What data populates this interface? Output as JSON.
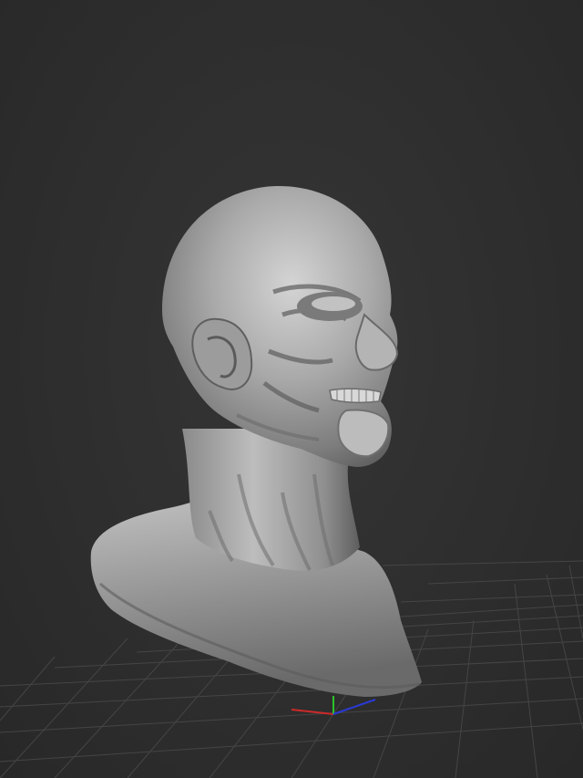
{
  "viewport": {
    "view": "3d-sculpt-viewport",
    "model": "bust",
    "background_color": "#2e2e2e",
    "grid_color": "#4a4a4a",
    "grid_visible": true,
    "gizmo_axes": [
      {
        "axis": "x",
        "color": "#cc2a2a"
      },
      {
        "axis": "y",
        "color": "#2ac42a"
      },
      {
        "axis": "z",
        "color": "#2a3ad4"
      }
    ]
  }
}
